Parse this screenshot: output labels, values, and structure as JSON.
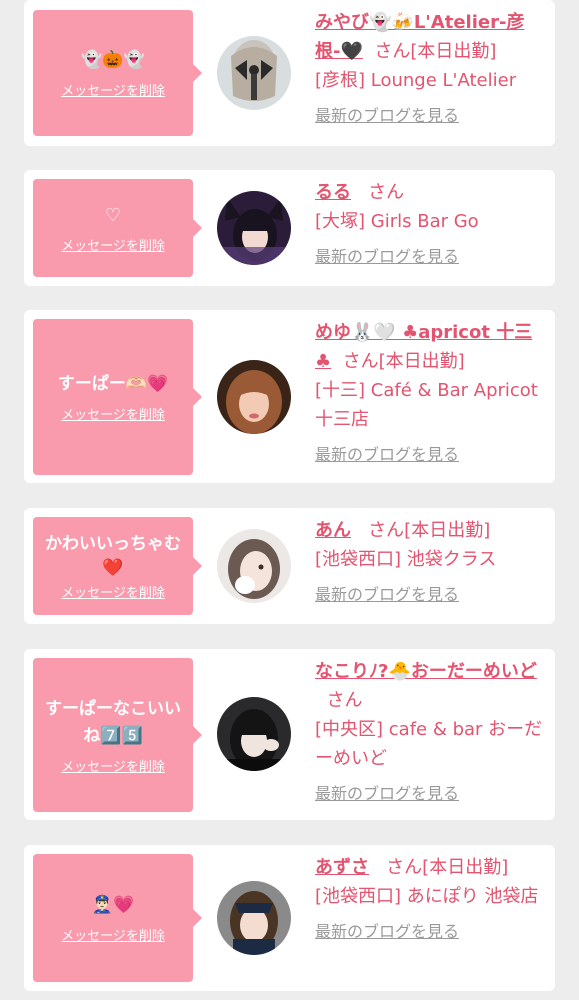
{
  "colors": {
    "bubble": "#f99aad",
    "name_pink": "#e2546f",
    "link_gray": "#9a9a9a",
    "background": "#ededed"
  },
  "cards": [
    {
      "message": "👻🎃👻",
      "delete_label": "メッセージを削除",
      "name": "みやび👻🍻L'Atelier-彦根-🖤",
      "san": "さん",
      "status": "[本日出勤]",
      "shop": "[彦根] Lounge L'Atelier",
      "blog_label": "最新のブログを見る",
      "avatar_icon": "girl-photo-ribbon"
    },
    {
      "message": "♡",
      "delete_label": "メッセージを削除",
      "name": "るる",
      "san": "さん",
      "status": "",
      "shop": "[大塚] Girls Bar Go",
      "blog_label": "最新のブログを見る",
      "avatar_icon": "girl-photo-catears"
    },
    {
      "message": "すーぱー🫶🏻💗",
      "delete_label": "メッセージを削除",
      "name": "めゆ🐰🤍 ♣apricot 十三♣",
      "san": "さん",
      "status": "[本日出勤]",
      "shop": "[十三] Café & Bar Apricot 十三店",
      "blog_label": "最新のブログを見る",
      "avatar_icon": "girl-photo-brown-hair"
    },
    {
      "message": "かわいいっちゃむ❤️",
      "delete_label": "メッセージを削除",
      "name": "あん",
      "san": "さん",
      "status": "[本日出勤]",
      "shop": "[池袋西口] 池袋クラス",
      "blog_label": "最新のブログを見る",
      "avatar_icon": "girl-photo-light"
    },
    {
      "message": "すーぱーなこいいね7️⃣5️⃣",
      "delete_label": "メッセージを削除",
      "name": "なこりﾉ?🐣おーだーめいど",
      "san": "さん",
      "status": "",
      "shop": "[中央区] cafe & bar おーだーめいど",
      "blog_label": "最新のブログを見る",
      "avatar_icon": "girl-photo-dark"
    },
    {
      "message": "👮🏻‍♂️💗",
      "delete_label": "メッセージを削除",
      "name": "あずさ",
      "san": "さん",
      "status": "[本日出勤]",
      "shop": "[池袋西口] あにぽり 池袋店",
      "blog_label": "最新のブログを見る",
      "avatar_icon": "girl-photo-police"
    }
  ]
}
